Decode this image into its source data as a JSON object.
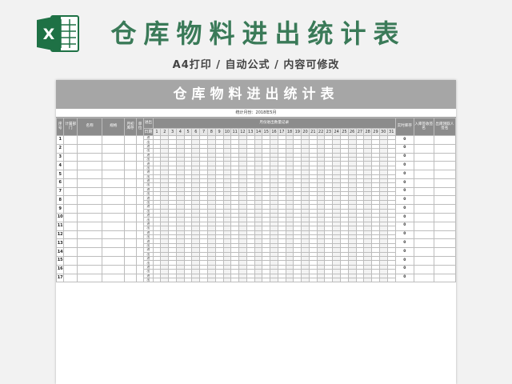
{
  "banner": {
    "logo_letter": "X",
    "title": "仓库物料进出统计表",
    "subtitle": "A4打印 / 自动公式 / 内容可修改",
    "logo_color": "#1e7145",
    "title_color": "#3a7a58"
  },
  "sheet": {
    "title": "仓库物料进出统计表",
    "period": "统计月份：2018年5月",
    "headers": {
      "seq": "序号",
      "dept": "计属部门",
      "name": "名称",
      "spec": "规格",
      "opening": "月初库存",
      "unit": "单位",
      "io": "进出",
      "daily": "月份进出数量记录",
      "date": "日期",
      "stock": "实时库存",
      "in_sign": "入库签收签名",
      "out_sign": "出库领取人签名"
    },
    "days": [
      "1",
      "2",
      "3",
      "4",
      "5",
      "6",
      "7",
      "8",
      "9",
      "10",
      "11",
      "12",
      "13",
      "14",
      "15",
      "16",
      "17",
      "18",
      "19",
      "20",
      "21",
      "22",
      "23",
      "24",
      "25",
      "26",
      "27",
      "28",
      "29",
      "30",
      "31"
    ],
    "in_label": "进",
    "out_label": "出",
    "stock_value": "0",
    "rows": [
      "1",
      "2",
      "3",
      "4",
      "5",
      "6",
      "7",
      "8",
      "9",
      "10",
      "11",
      "12",
      "13",
      "14",
      "15",
      "16",
      "17"
    ]
  }
}
